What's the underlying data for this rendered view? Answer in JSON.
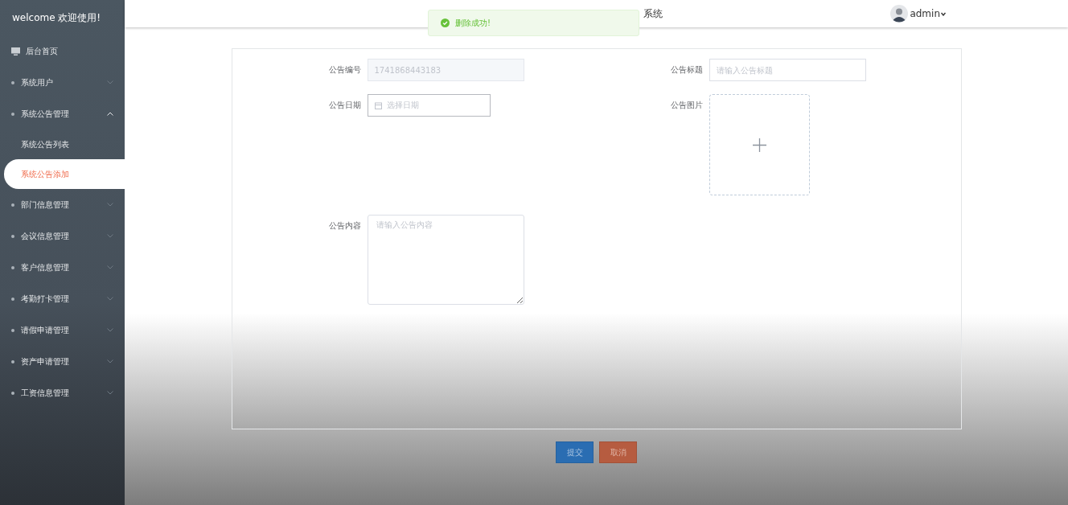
{
  "sidebar": {
    "welcome": "welcome 欢迎使用!",
    "items": [
      {
        "kind": "home",
        "label": "后台首页"
      },
      {
        "kind": "group",
        "label": "系统用户",
        "expanded": false
      },
      {
        "kind": "group",
        "label": "系统公告管理",
        "expanded": true
      },
      {
        "kind": "sub",
        "label": "系统公告列表",
        "selected": false
      },
      {
        "kind": "sub",
        "label": "系统公告添加",
        "selected": true
      },
      {
        "kind": "group",
        "label": "部门信息管理",
        "expanded": false
      },
      {
        "kind": "group",
        "label": "会议信息管理",
        "expanded": false
      },
      {
        "kind": "group",
        "label": "客户信息管理",
        "expanded": false
      },
      {
        "kind": "group",
        "label": "考勤打卡管理",
        "expanded": false
      },
      {
        "kind": "group",
        "label": "请假申请管理",
        "expanded": false
      },
      {
        "kind": "group",
        "label": "资产申请管理",
        "expanded": false
      },
      {
        "kind": "group",
        "label": "工资信息管理",
        "expanded": false
      }
    ]
  },
  "header": {
    "title": "系统",
    "user": "admin"
  },
  "toast": {
    "message": "删除成功!"
  },
  "form": {
    "id_label": "公告编号",
    "id_value": "1741868443183",
    "title_label": "公告标题",
    "title_placeholder": "请输入公告标题",
    "date_label": "公告日期",
    "date_placeholder": "选择日期",
    "image_label": "公告图片",
    "content_label": "公告内容",
    "content_placeholder": "请输入公告内容"
  },
  "buttons": [
    {
      "kind": "primary",
      "label": "提交"
    },
    {
      "kind": "danger",
      "label": "取消"
    }
  ]
}
